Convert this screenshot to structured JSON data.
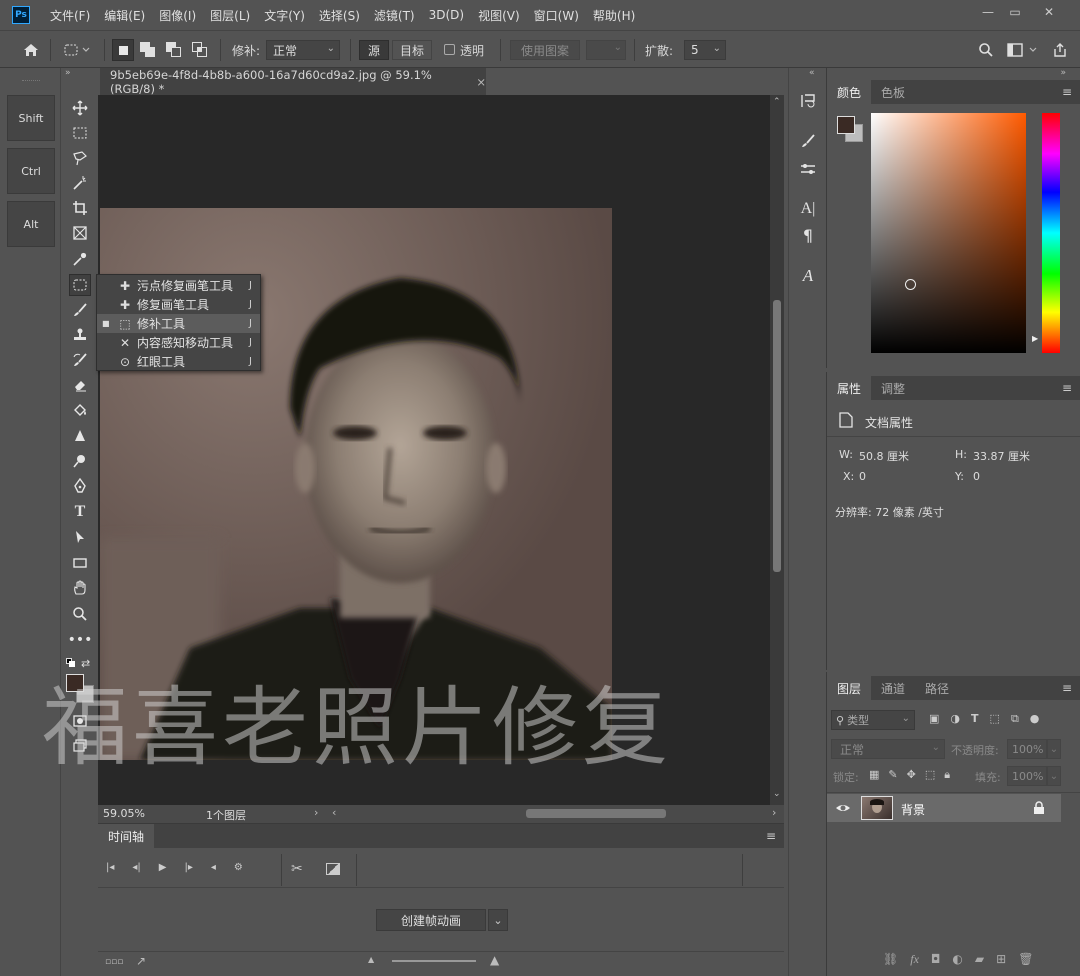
{
  "app": {
    "logo": "Ps"
  },
  "menu": [
    "文件(F)",
    "编辑(E)",
    "图像(I)",
    "图层(L)",
    "文字(Y)",
    "选择(S)",
    "滤镜(T)",
    "3D(D)",
    "视图(V)",
    "窗口(W)",
    "帮助(H)"
  ],
  "window_controls": {
    "minimize": "—",
    "restore": "▭",
    "close": "✕"
  },
  "options": {
    "patch_label": "修补:",
    "patch_mode": "正常",
    "source": "源",
    "target": "目标",
    "transparent": "透明",
    "use_pattern": "使用图案",
    "diffusion_label": "扩散:",
    "diffusion_value": "5"
  },
  "shortcuts": [
    "Shift",
    "Ctrl",
    "Alt"
  ],
  "document": {
    "tab_title": "9b5eb69e-4f8d-4b8b-a600-16a7d60cd9a2.jpg @ 59.1%(RGB/8) *",
    "tab_close": "×",
    "zoom": "59.05%",
    "layers_count": "1个图层"
  },
  "tool_flyout": [
    {
      "icon": "spot-healing-brush-icon",
      "label": "污点修复画笔工具",
      "key": "J",
      "selected": false
    },
    {
      "icon": "healing-brush-icon",
      "label": "修复画笔工具",
      "key": "J",
      "selected": false
    },
    {
      "icon": "patch-tool-icon",
      "label": "修补工具",
      "key": "J",
      "selected": true
    },
    {
      "icon": "content-aware-move-icon",
      "label": "内容感知移动工具",
      "key": "J",
      "selected": false
    },
    {
      "icon": "red-eye-icon",
      "label": "红眼工具",
      "key": "J",
      "selected": false
    }
  ],
  "watermark": "福喜老照片修复",
  "timeline": {
    "tab": "时间轴",
    "create_button": "创建帧动画"
  },
  "color_panel": {
    "tabs": [
      "颜色",
      "色板"
    ],
    "foreground": "#3a2a24",
    "background": "#bdbdbd",
    "hue_color": "#ff5a00"
  },
  "properties_panel": {
    "tabs": [
      "属性",
      "调整"
    ],
    "title": "文档属性",
    "w_label": "W:",
    "w_value": "50.8 厘米",
    "h_label": "H:",
    "h_value": "33.87 厘米",
    "x_label": "X:",
    "x_value": "0",
    "y_label": "Y:",
    "y_value": "0",
    "resolution": "分辨率: 72 像素 /英寸"
  },
  "layers_panel": {
    "tabs": [
      "图层",
      "通道",
      "路径"
    ],
    "kind_filter": "类型",
    "blend_mode": "正常",
    "opacity_label": "不透明度:",
    "opacity_value": "100%",
    "lock_label": "锁定:",
    "fill_label": "填充:",
    "fill_value": "100%",
    "layers": [
      {
        "name": "背景",
        "visible": true,
        "locked": true
      }
    ]
  }
}
